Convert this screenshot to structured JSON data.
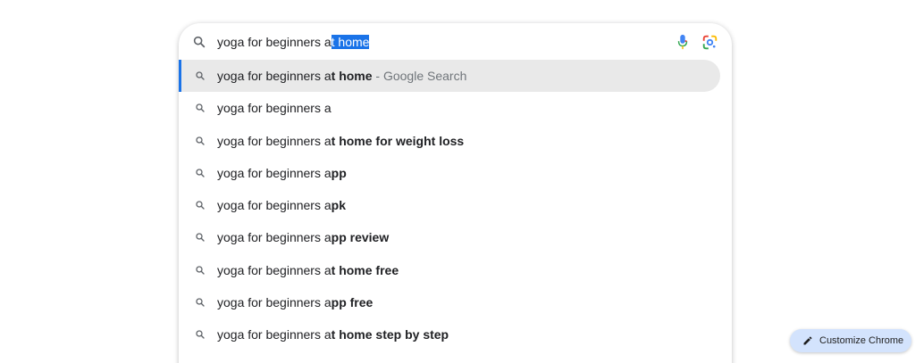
{
  "search": {
    "query_typed": "yoga for beginners a",
    "query_selected": "t home",
    "icons": {
      "search": "search-icon",
      "mic": "mic-icon",
      "lens": "google-lens-icon"
    }
  },
  "suggestions": [
    {
      "prefix": "yoga for beginners a",
      "bold": "t home",
      "suffix": " - Google Search",
      "active": true
    },
    {
      "prefix": "yoga for beginners a",
      "bold": "",
      "suffix": "",
      "active": false
    },
    {
      "prefix": "yoga for beginners a",
      "bold": "t home for weight loss",
      "suffix": "",
      "active": false
    },
    {
      "prefix": "yoga for beginners a",
      "bold": "pp",
      "suffix": "",
      "active": false
    },
    {
      "prefix": "yoga for beginners a",
      "bold": "pk",
      "suffix": "",
      "active": false
    },
    {
      "prefix": "yoga for beginners a",
      "bold": "pp review",
      "suffix": "",
      "active": false
    },
    {
      "prefix": "yoga for beginners a",
      "bold": "t home free",
      "suffix": "",
      "active": false
    },
    {
      "prefix": "yoga for beginners a",
      "bold": "pp free",
      "suffix": "",
      "active": false
    },
    {
      "prefix": "yoga for beginners a",
      "bold": "t home step by step",
      "suffix": "",
      "active": false
    }
  ],
  "customize": {
    "label": "Customize Chrome",
    "icon": "pencil-icon"
  },
  "colors": {
    "accent": "#1a73e8",
    "active_row": "#e9e9e9",
    "customize_bg": "#d3e3fd"
  }
}
